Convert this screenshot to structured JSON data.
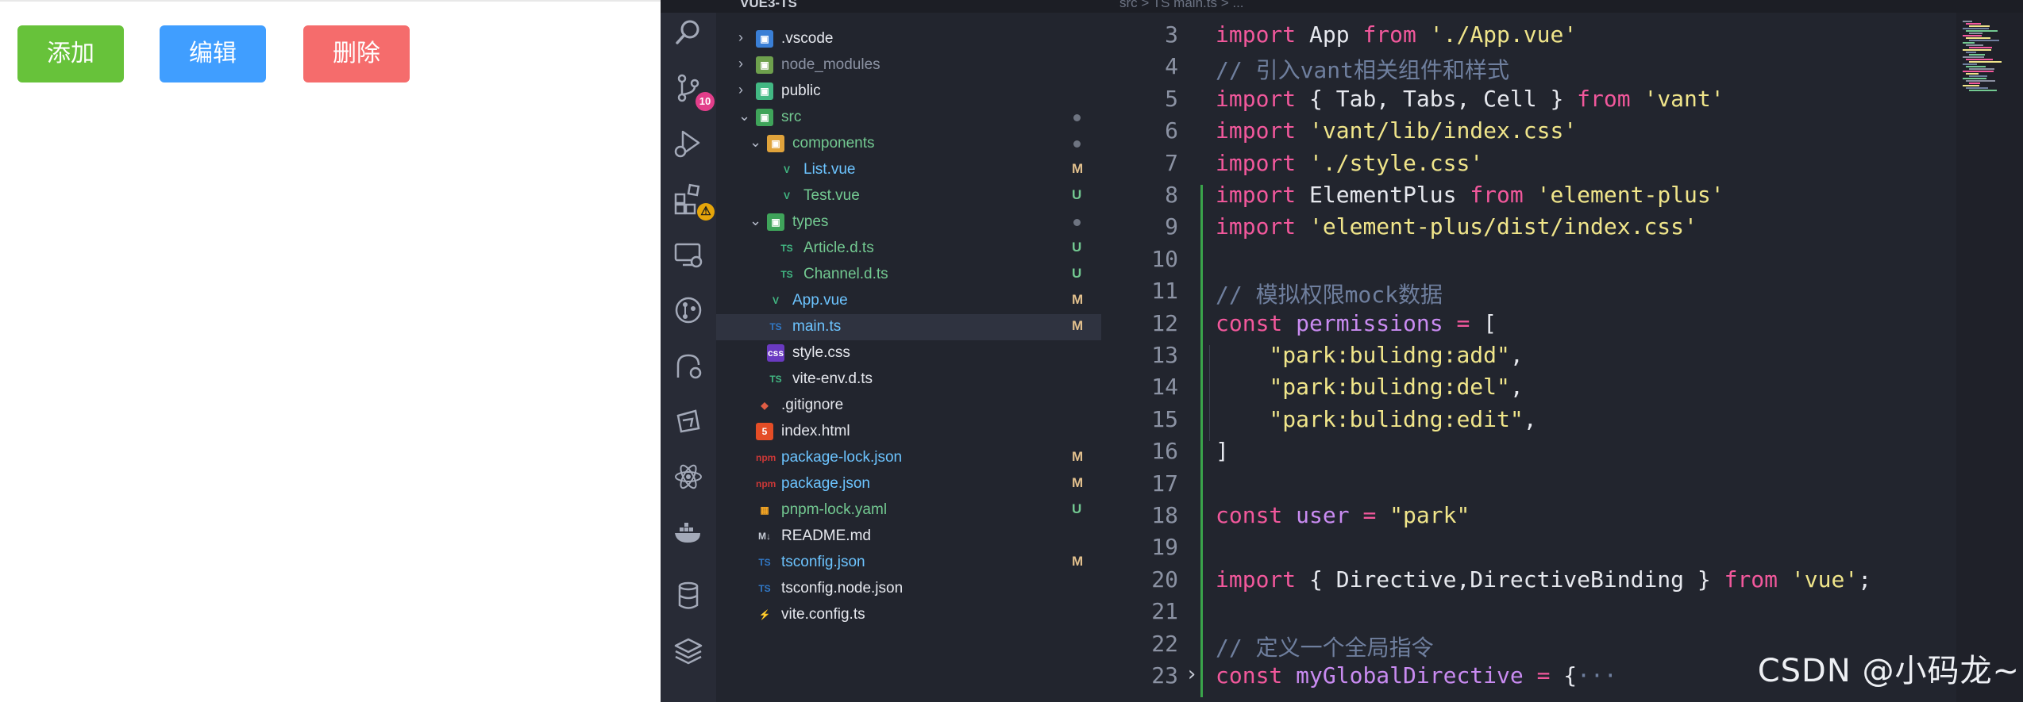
{
  "demo": {
    "buttons": [
      {
        "label": "添加",
        "color": "#67c23a"
      },
      {
        "label": "编辑",
        "color": "#409eff"
      },
      {
        "label": "删除",
        "color": "#f56c6c"
      }
    ]
  },
  "titlebar": {
    "folder": "VUE3-TS",
    "breadcrumb": "src > TS main.ts > ..."
  },
  "activity_bar": {
    "icons": [
      "search-icon",
      "source-control-icon",
      "run-debug-icon",
      "extensions-icon",
      "remote-explorer-icon",
      "git-graph-icon",
      "git-history-icon",
      "share-icon",
      "react-icon",
      "docker-icon",
      "database-icon",
      "layers-icon"
    ],
    "source_control_badge": "10",
    "extensions_badge": "⚠"
  },
  "explorer": {
    "items": [
      {
        "name": ".vscode",
        "status": "",
        "color": "#e6e8ee"
      },
      {
        "name": "node_modules",
        "status": "",
        "color": "#8b92a3"
      },
      {
        "name": "public",
        "status": "",
        "color": "#e6e8ee"
      },
      {
        "name": "src",
        "status": "•",
        "color": "#73c991"
      },
      {
        "name": "components",
        "status": "•",
        "color": "#73c991"
      },
      {
        "name": "List.vue",
        "status": "M",
        "color": "#6cc4ff"
      },
      {
        "name": "Test.vue",
        "status": "U",
        "color": "#73c991"
      },
      {
        "name": "types",
        "status": "•",
        "color": "#73c991"
      },
      {
        "name": "Article.d.ts",
        "status": "U",
        "color": "#73c991"
      },
      {
        "name": "Channel.d.ts",
        "status": "U",
        "color": "#73c991"
      },
      {
        "name": "App.vue",
        "status": "M",
        "color": "#6cc4ff"
      },
      {
        "name": "main.ts",
        "status": "M",
        "color": "#6cc4ff"
      },
      {
        "name": "style.css",
        "status": "",
        "color": "#e6e8ee"
      },
      {
        "name": "vite-env.d.ts",
        "status": "",
        "color": "#e6e8ee"
      },
      {
        "name": ".gitignore",
        "status": "",
        "color": "#e6e8ee"
      },
      {
        "name": "index.html",
        "status": "",
        "color": "#e6e8ee"
      },
      {
        "name": "package-lock.json",
        "status": "M",
        "color": "#6cc4ff"
      },
      {
        "name": "package.json",
        "status": "M",
        "color": "#6cc4ff"
      },
      {
        "name": "pnpm-lock.yaml",
        "status": "U",
        "color": "#73c991"
      },
      {
        "name": "README.md",
        "status": "",
        "color": "#e6e8ee"
      },
      {
        "name": "tsconfig.json",
        "status": "M",
        "color": "#6cc4ff"
      },
      {
        "name": "tsconfig.node.json",
        "status": "",
        "color": "#e6e8ee"
      },
      {
        "name": "vite.config.ts",
        "status": "",
        "color": "#e6e8ee"
      }
    ]
  },
  "editor": {
    "lines": [
      {
        "n": "3",
        "tokens": [
          [
            "k",
            "import"
          ],
          [
            "t",
            " App "
          ],
          [
            "k",
            "from"
          ],
          [
            "t",
            " "
          ],
          [
            "s",
            "'./App.vue'"
          ]
        ]
      },
      {
        "n": "4",
        "tokens": [
          [
            "c",
            "// 引入vant相关组件和样式"
          ]
        ]
      },
      {
        "n": "5",
        "tokens": [
          [
            "k",
            "import"
          ],
          [
            "t",
            " { Tab, Tabs, Cell } "
          ],
          [
            "k",
            "from"
          ],
          [
            "t",
            " "
          ],
          [
            "s",
            "'vant'"
          ]
        ]
      },
      {
        "n": "6",
        "tokens": [
          [
            "k",
            "import"
          ],
          [
            "t",
            " "
          ],
          [
            "s",
            "'vant/lib/index.css'"
          ]
        ]
      },
      {
        "n": "7",
        "tokens": [
          [
            "k",
            "import"
          ],
          [
            "t",
            " "
          ],
          [
            "s",
            "'./style.css'"
          ]
        ]
      },
      {
        "n": "8",
        "tokens": [
          [
            "k",
            "import"
          ],
          [
            "t",
            " ElementPlus "
          ],
          [
            "k",
            "from"
          ],
          [
            "t",
            " "
          ],
          [
            "s",
            "'element-plus'"
          ]
        ]
      },
      {
        "n": "9",
        "tokens": [
          [
            "k",
            "import"
          ],
          [
            "t",
            " "
          ],
          [
            "s",
            "'element-plus/dist/index.css'"
          ]
        ]
      },
      {
        "n": "10",
        "tokens": []
      },
      {
        "n": "11",
        "tokens": [
          [
            "c",
            "// 模拟权限mock数据"
          ]
        ]
      },
      {
        "n": "12",
        "tokens": [
          [
            "k",
            "const"
          ],
          [
            "t",
            " "
          ],
          [
            "v",
            "permissions"
          ],
          [
            "t",
            " "
          ],
          [
            "k",
            "="
          ],
          [
            "t",
            " ["
          ]
        ]
      },
      {
        "n": "13",
        "tokens": [
          [
            "t",
            "    "
          ],
          [
            "s",
            "\"park:bulidng:add\""
          ],
          [
            "t",
            ","
          ]
        ]
      },
      {
        "n": "14",
        "tokens": [
          [
            "t",
            "    "
          ],
          [
            "s",
            "\"park:bulidng:del\""
          ],
          [
            "t",
            ","
          ]
        ]
      },
      {
        "n": "15",
        "tokens": [
          [
            "t",
            "    "
          ],
          [
            "s",
            "\"park:bulidng:edit\""
          ],
          [
            "t",
            ","
          ]
        ]
      },
      {
        "n": "16",
        "tokens": [
          [
            "t",
            "]"
          ]
        ]
      },
      {
        "n": "17",
        "tokens": []
      },
      {
        "n": "18",
        "tokens": [
          [
            "k",
            "const"
          ],
          [
            "t",
            " "
          ],
          [
            "v",
            "user"
          ],
          [
            "t",
            " "
          ],
          [
            "k",
            "="
          ],
          [
            "t",
            " "
          ],
          [
            "s",
            "\"park\""
          ]
        ]
      },
      {
        "n": "19",
        "tokens": []
      },
      {
        "n": "20",
        "tokens": [
          [
            "k",
            "import"
          ],
          [
            "t",
            " { Directive,DirectiveBinding } "
          ],
          [
            "k",
            "from"
          ],
          [
            "t",
            " "
          ],
          [
            "s",
            "'vue'"
          ],
          [
            "t",
            ";"
          ]
        ]
      },
      {
        "n": "21",
        "tokens": []
      },
      {
        "n": "22",
        "tokens": [
          [
            "c",
            "// 定义一个全局指令"
          ]
        ]
      },
      {
        "n": "23",
        "tokens": [
          [
            "k",
            "const"
          ],
          [
            "t",
            " "
          ],
          [
            "v",
            "myGlobalDirective"
          ],
          [
            "t",
            " "
          ],
          [
            "k",
            "="
          ],
          [
            "t",
            " {"
          ],
          [
            "c",
            "···"
          ]
        ]
      }
    ]
  },
  "watermark": "CSDN @小码龙~"
}
